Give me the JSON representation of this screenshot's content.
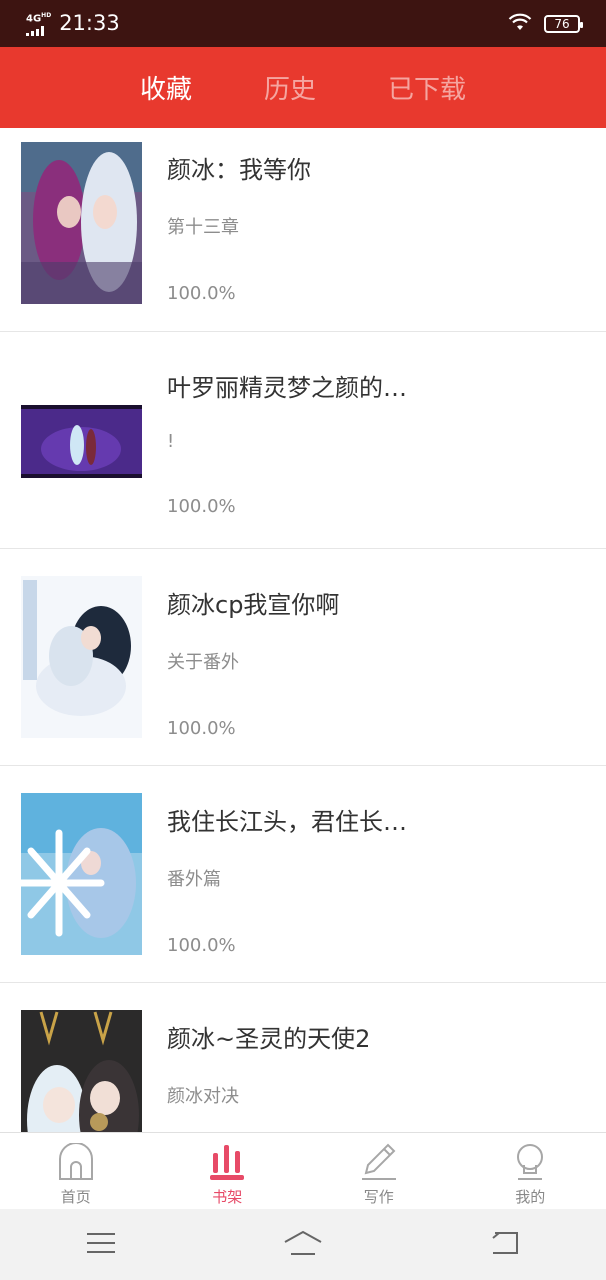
{
  "status_bar": {
    "network": "4G",
    "network_suffix": "HD",
    "time": "21:33",
    "battery": "76"
  },
  "tabs": [
    {
      "label": "收藏",
      "active": true
    },
    {
      "label": "历史",
      "active": false
    },
    {
      "label": "已下载",
      "active": false
    }
  ],
  "books": [
    {
      "title": "颜冰：我等你",
      "subtitle": "第十三章",
      "progress": "100.0%",
      "cover": "cover-image"
    },
    {
      "title": "叶罗丽精灵梦之颜的…",
      "subtitle": "!",
      "progress": "100.0%",
      "cover": "cover-image"
    },
    {
      "title": "颜冰cp我宣你啊",
      "subtitle": "关于番外",
      "progress": "100.0%",
      "cover": "cover-image"
    },
    {
      "title": "我住长江头，君住长…",
      "subtitle": "番外篇",
      "progress": "100.0%",
      "cover": "cover-image"
    },
    {
      "title": "颜冰~圣灵的天使2",
      "subtitle": "颜冰对决",
      "progress": "",
      "cover": "cover-image"
    }
  ],
  "bottom_nav": [
    {
      "label": "首页",
      "icon": "home-icon",
      "active": false
    },
    {
      "label": "书架",
      "icon": "bookshelf-icon",
      "active": true
    },
    {
      "label": "写作",
      "icon": "pencil-icon",
      "active": false
    },
    {
      "label": "我的",
      "icon": "profile-icon",
      "active": false
    }
  ],
  "colors": {
    "header_red": "#e8392e",
    "status_bg": "#3d1411",
    "active_nav": "#e74a67"
  }
}
